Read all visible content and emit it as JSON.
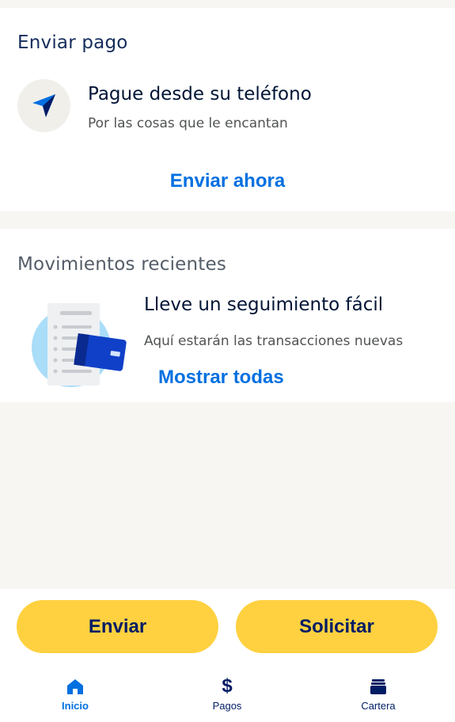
{
  "send_card": {
    "title": "Enviar pago",
    "headline": "Pague desde su teléfono",
    "subtitle": "Por las cosas que le encantan",
    "action_label": "Enviar ahora",
    "icon": "paper-plane-icon"
  },
  "activity_card": {
    "title": "Movimientos recientes",
    "headline": "Lleve un seguimiento fácil",
    "subtitle": "Aquí estarán las transacciones nuevas",
    "action_label": "Mostrar todas",
    "illustration": "receipt-card-illustration"
  },
  "actions": {
    "send_label": "Enviar",
    "request_label": "Solicitar"
  },
  "nav": {
    "items": [
      {
        "label": "Inicio",
        "icon": "home-icon",
        "active": true
      },
      {
        "label": "Pagos",
        "icon": "dollar-icon",
        "active": false
      },
      {
        "label": "Cartera",
        "icon": "wallet-icon",
        "active": false
      }
    ]
  },
  "colors": {
    "accent_blue": "#0070e0",
    "navy": "#001c64",
    "button_yellow": "#ffd140",
    "background": "#f7f6f2"
  }
}
